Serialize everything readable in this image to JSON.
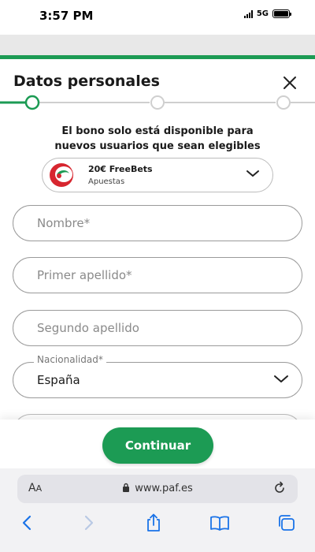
{
  "status": {
    "time": "3:57 PM",
    "network": "5G"
  },
  "sheet": {
    "title": "Datos personales",
    "bonus_text_line1": "El bono solo está disponible para",
    "bonus_text_line2": "nuevos usuarios que sean elegibles",
    "bonus": {
      "title": "20€ FreeBets",
      "subtitle": "Apuestas"
    }
  },
  "form": {
    "nombre_placeholder": "Nombre*",
    "primer_apellido_placeholder": "Primer apellido*",
    "segundo_apellido_placeholder": "Segundo apellido",
    "nacionalidad_label": "Nacionalidad*",
    "nacionalidad_value": "España"
  },
  "footer": {
    "continue_label": "Continuar"
  },
  "browser": {
    "aa_label": "A",
    "aa_small": "A",
    "url": "www.paf.es"
  },
  "colors": {
    "accent": "#1c9b54",
    "brand_red": "#d7262f"
  }
}
